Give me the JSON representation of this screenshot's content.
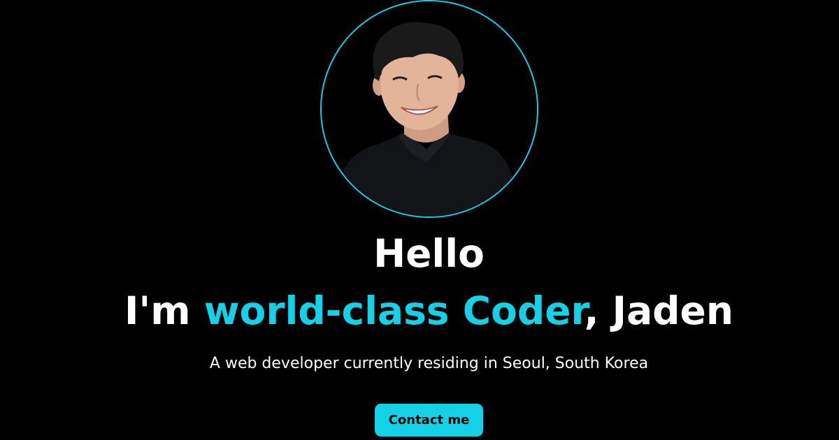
{
  "colors": {
    "background": "#000000",
    "accent": "#13d2e8",
    "text": "#ffffff",
    "button_text": "#000000"
  },
  "hero": {
    "greeting": "Hello",
    "headline_prefix": "I'm ",
    "headline_accent": "world-class Coder",
    "headline_suffix": ", Jaden",
    "subtitle": "A web developer currently residing in Seoul, South Korea",
    "contact_button_label": "Contact me",
    "avatar_icon": "profile-photo"
  }
}
